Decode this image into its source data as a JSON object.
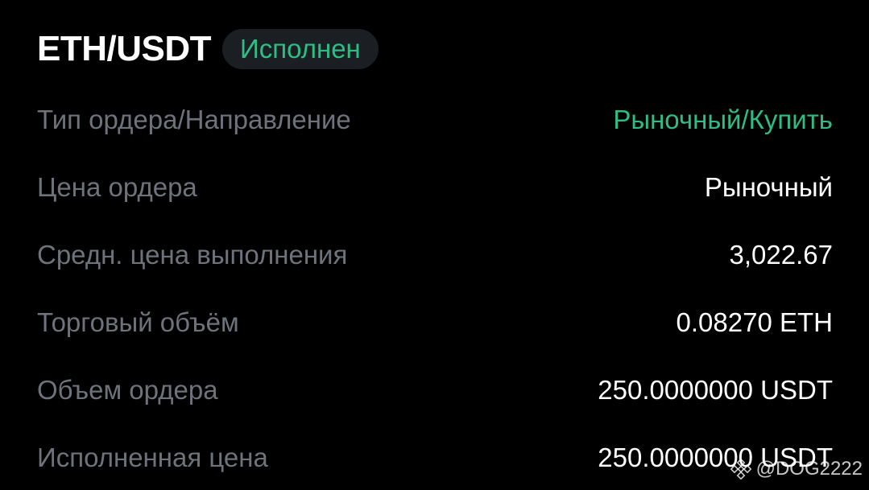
{
  "header": {
    "pair": "ETH/USDT",
    "status": "Исполнен"
  },
  "rows": [
    {
      "label": "Тип ордера/Направление",
      "value": "Рыночный/Купить",
      "accent": true
    },
    {
      "label": "Цена ордера",
      "value": "Рыночный"
    },
    {
      "label": "Средн. цена выполнения",
      "value": "3,022.67"
    },
    {
      "label": "Торговый объём",
      "value": "0.08270 ETH"
    },
    {
      "label": "Объем ордера",
      "value": "250.0000000 USDT"
    },
    {
      "label": "Исполненная цена",
      "value": "250.0000000 USDT"
    }
  ],
  "watermark": {
    "icon": "binance-logo-icon",
    "text": "@DOG2222"
  },
  "colors": {
    "background": "#000000",
    "accent_green": "#2ebd85",
    "label_gray": "#6e737b",
    "badge_bg": "#1b1f23"
  }
}
